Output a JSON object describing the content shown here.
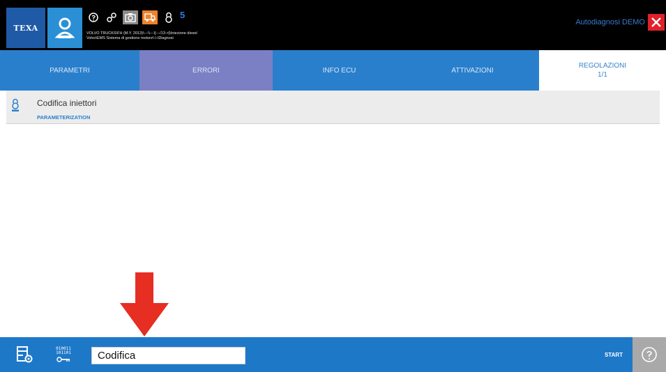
{
  "header": {
    "logo_text": "TEXA",
    "notification_count": "5",
    "vehicle_line1": "VOLVO TRUCKS\\FH (M.Y. 2013)\\---\\\\---\\[---/13->]\\Iniezione diesel",
    "vehicle_line2": "Volvo\\EMS Sistema di gestione motore\\-\\-\\Diagnosi",
    "mode_label": "Autodiagnosi DEMO"
  },
  "tabs": [
    {
      "label": "PARAMETRI"
    },
    {
      "label": "ERRORI"
    },
    {
      "label": "INFO ECU"
    },
    {
      "label": "ATTIVAZIONI"
    },
    {
      "label": "REGOLAZIONI",
      "counter": "1/1"
    }
  ],
  "content": {
    "title": "Codifica iniettori",
    "subtitle": "PARAMETERIZATION"
  },
  "bottom": {
    "binary_top": "010011",
    "binary_bottom": "101101",
    "code_value": "Codifica",
    "start_label": "START"
  },
  "colors": {
    "brand_blue": "#1e78c8",
    "active_tab": "#7b7fc4",
    "arrow_red": "#e62e22",
    "close_red": "#e0202a"
  }
}
